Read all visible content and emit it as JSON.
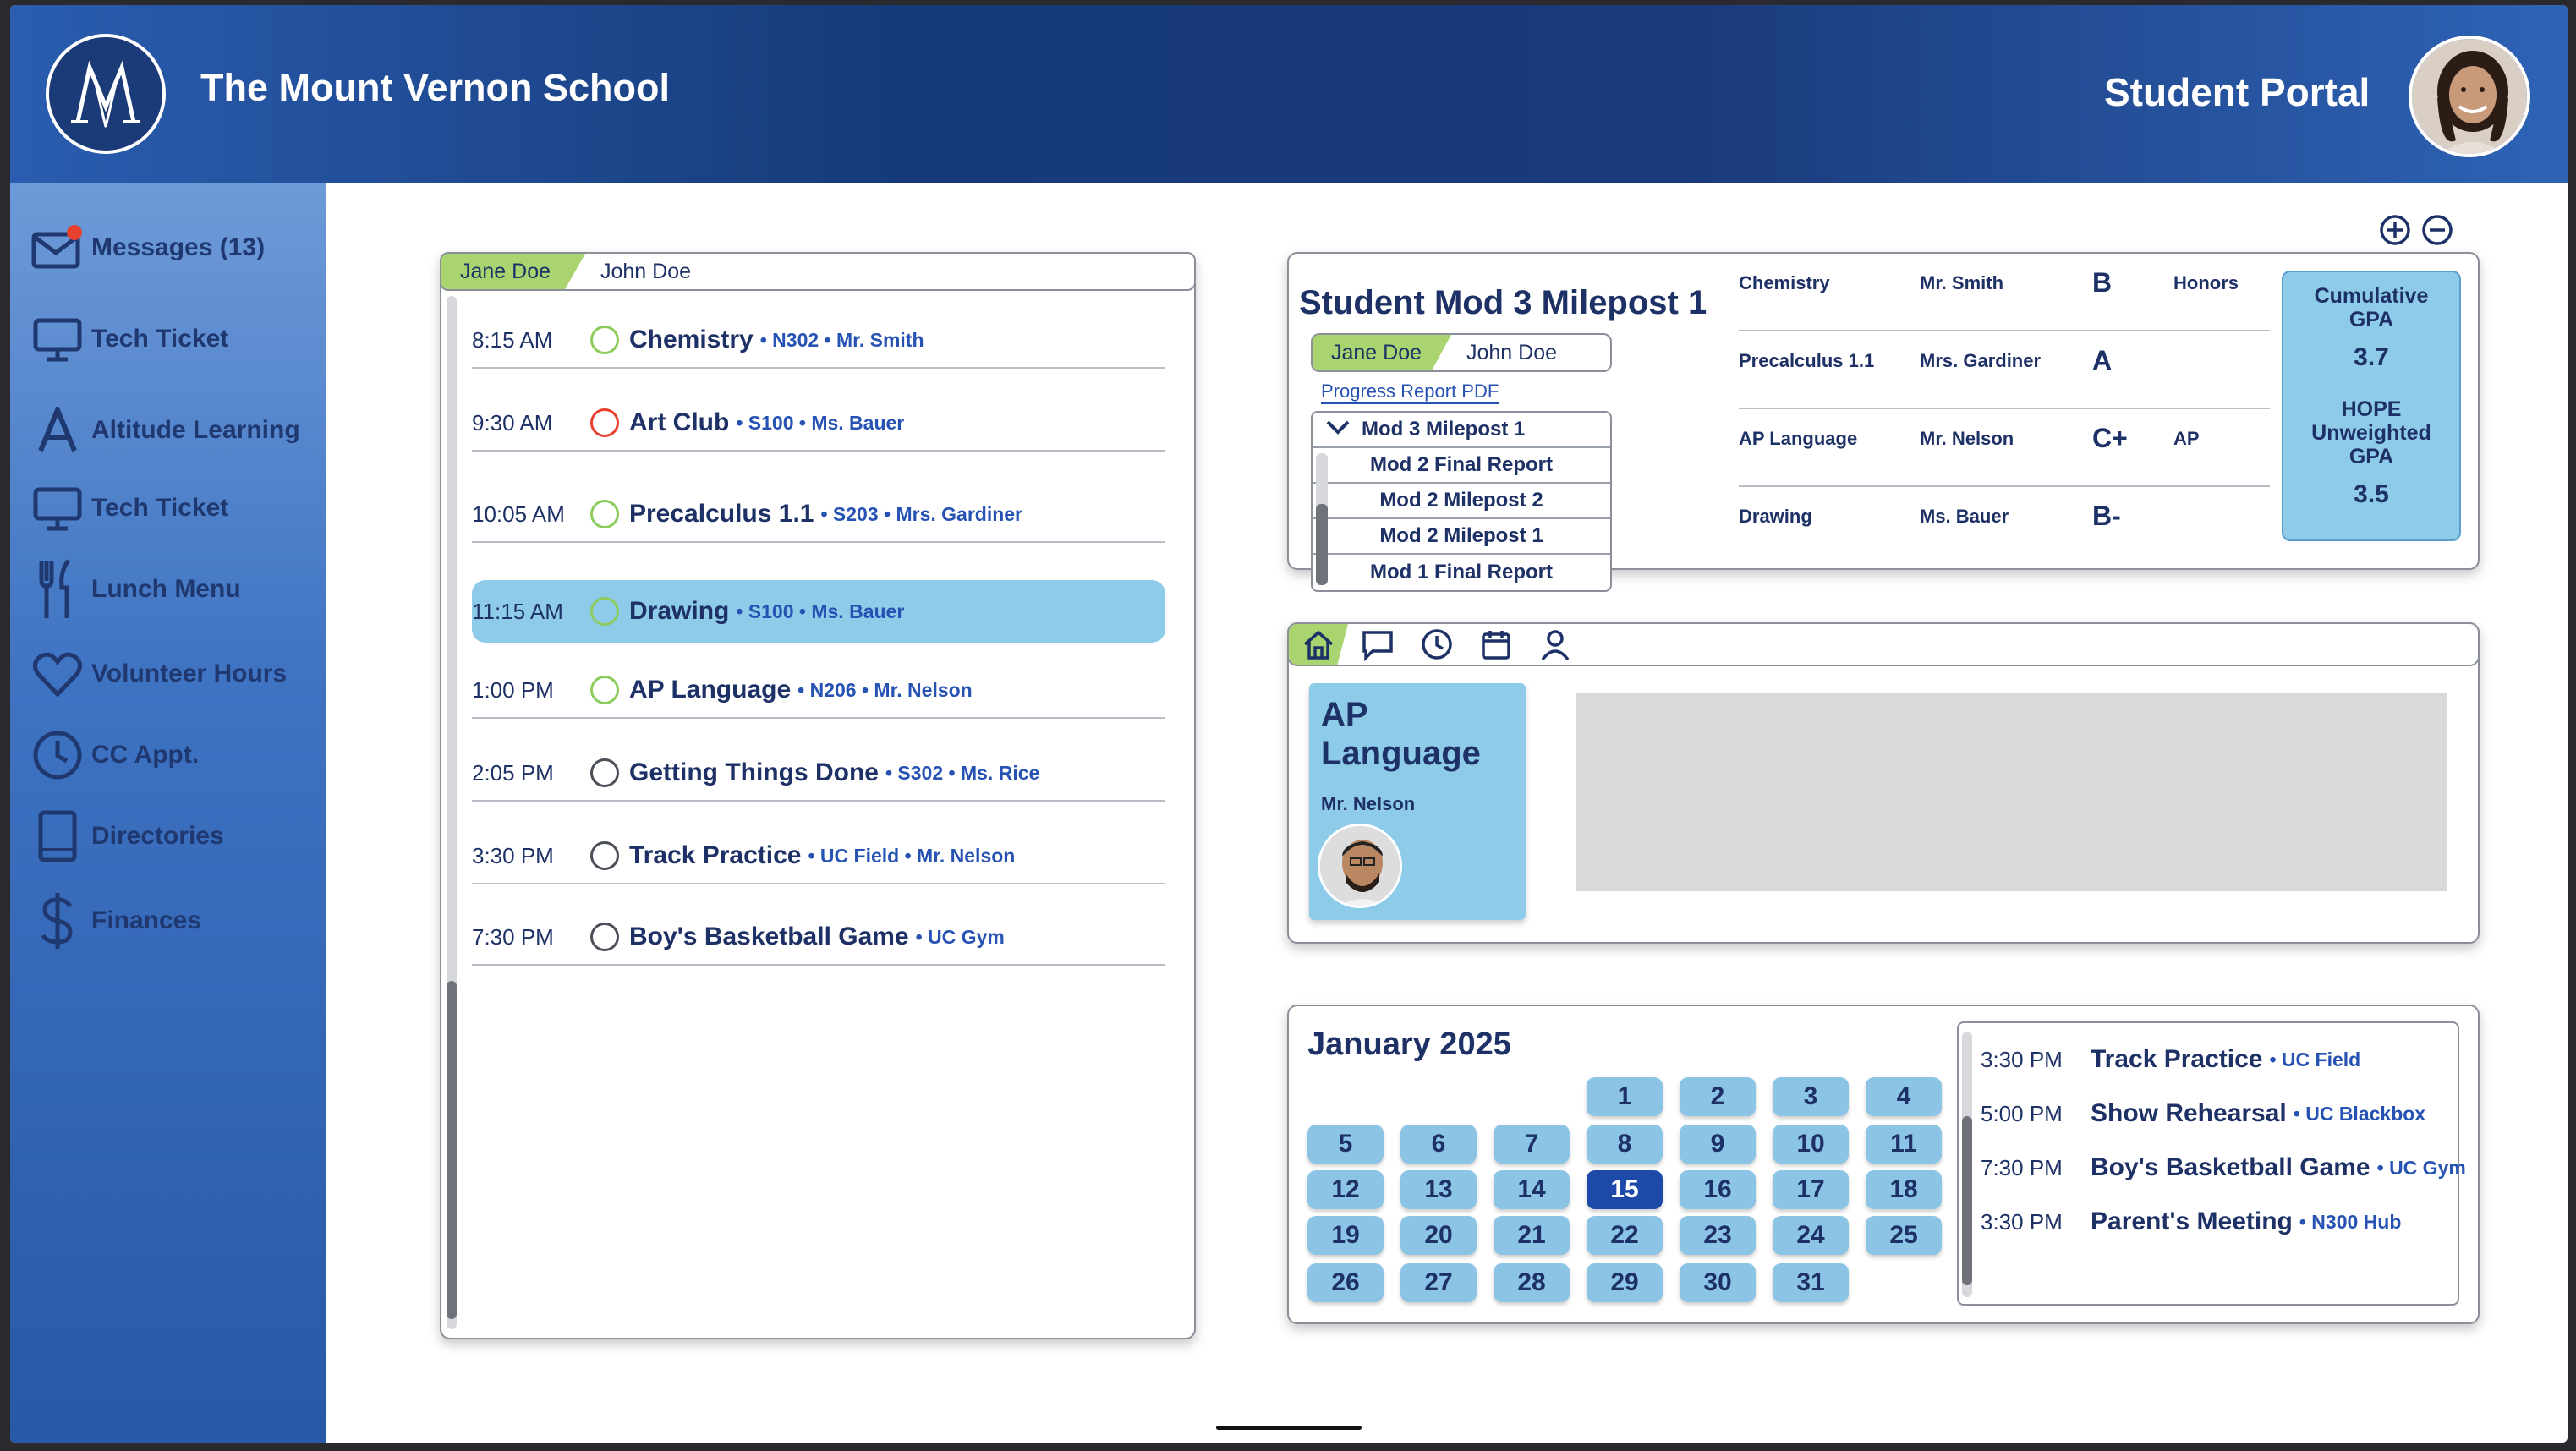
{
  "header": {
    "school_name": "The Mount Vernon School",
    "portal_title": "Student Portal"
  },
  "sidebar": {
    "items": [
      {
        "label": "Messages (13)",
        "icon": "mail-icon"
      },
      {
        "label": "Tech Ticket",
        "icon": "monitor-icon"
      },
      {
        "label": "Altitude Learning",
        "icon": "letter-a-icon"
      },
      {
        "label": "Tech Ticket",
        "icon": "monitor-icon"
      },
      {
        "label": "Lunch Menu",
        "icon": "utensils-icon"
      },
      {
        "label": "Volunteer Hours",
        "icon": "heart-icon"
      },
      {
        "label": "CC Appt.",
        "icon": "clock-icon"
      },
      {
        "label": "Directories",
        "icon": "book-icon"
      },
      {
        "label": "Finances",
        "icon": "dollar-icon"
      }
    ]
  },
  "schedule": {
    "students": [
      "Jane Doe",
      "John Doe"
    ],
    "rows": [
      {
        "time": "8:15 AM",
        "name": "Chemistry",
        "detail": "• N302 • Mr. Smith",
        "status": "green"
      },
      {
        "time": "9:30 AM",
        "name": "Art Club",
        "detail": "• S100 • Ms. Bauer",
        "status": "red"
      },
      {
        "time": "10:05 AM",
        "name": "Precalculus 1.1",
        "detail": "• S203 • Mrs. Gardiner",
        "status": "green"
      },
      {
        "time": "11:15 AM",
        "name": "Drawing",
        "detail": "• S100 • Ms. Bauer",
        "status": "green"
      },
      {
        "time": "1:00 PM",
        "name": "AP Language",
        "detail": "• N206 • Mr. Nelson",
        "status": "green"
      },
      {
        "time": "2:05 PM",
        "name": "Getting Things Done",
        "detail": "• S302 • Ms. Rice",
        "status": "gray"
      },
      {
        "time": "3:30 PM",
        "name": "Track Practice",
        "detail": "• UC Field • Mr. Nelson",
        "status": "gray"
      },
      {
        "time": "7:30 PM",
        "name": "Boy's Basketball Game",
        "detail": "• UC Gym",
        "status": "gray"
      }
    ]
  },
  "grades": {
    "title": "Student Mod 3 Milepost 1",
    "students": [
      "Jane Doe",
      "John Doe"
    ],
    "pdf_link": "Progress Report PDF",
    "dropdown": {
      "selected": "Mod 3 Milepost 1",
      "options": [
        "Mod 2 Final Report",
        "Mod 2 Milepost 2",
        "Mod 2 Milepost 1",
        "Mod 1 Final Report"
      ]
    },
    "rows": [
      {
        "course": "Chemistry",
        "teacher": "Mr. Smith",
        "grade": "B",
        "level": "Honors"
      },
      {
        "course": "Precalculus 1.1",
        "teacher": "Mrs. Gardiner",
        "grade": "A",
        "level": ""
      },
      {
        "course": "AP Language",
        "teacher": "Mr. Nelson",
        "grade": "C+",
        "level": "AP"
      },
      {
        "course": "Drawing",
        "teacher": "Ms. Bauer",
        "grade": "B-",
        "level": ""
      }
    ],
    "gpa": {
      "cumulative_label": "Cumulative GPA",
      "cumulative": "3.7",
      "hope_label": "HOPE Unweighted GPA",
      "hope": "3.5"
    }
  },
  "class_card": {
    "course": "AP Language",
    "teacher": "Mr. Nelson"
  },
  "calendar": {
    "month": "January 2025",
    "days": [
      "1",
      "2",
      "3",
      "4",
      "5",
      "6",
      "7",
      "8",
      "9",
      "10",
      "11",
      "12",
      "13",
      "14",
      "15",
      "16",
      "17",
      "18",
      "19",
      "20",
      "21",
      "22",
      "23",
      "24",
      "25",
      "26",
      "27",
      "28",
      "29",
      "30",
      "31"
    ],
    "selected_day": "15",
    "events": [
      {
        "time": "3:30 PM",
        "name": "Track Practice",
        "location": "• UC Field"
      },
      {
        "time": "5:00 PM",
        "name": "Show Rehearsal",
        "location": "• UC Blackbox"
      },
      {
        "time": "7:30 PM",
        "name": "Boy's Basketball Game",
        "location": "• UC Gym"
      },
      {
        "time": "3:30 PM",
        "name": "Parent's Meeting",
        "location": "• N300 Hub"
      }
    ]
  },
  "colors": {
    "header": "#1a3a78",
    "sidebar": "#3e73c2",
    "accent_green": "#a9d46f",
    "highlight_blue": "#8ecbe9",
    "text_navy": "#1e3166",
    "detail_blue": "#2552b3"
  }
}
